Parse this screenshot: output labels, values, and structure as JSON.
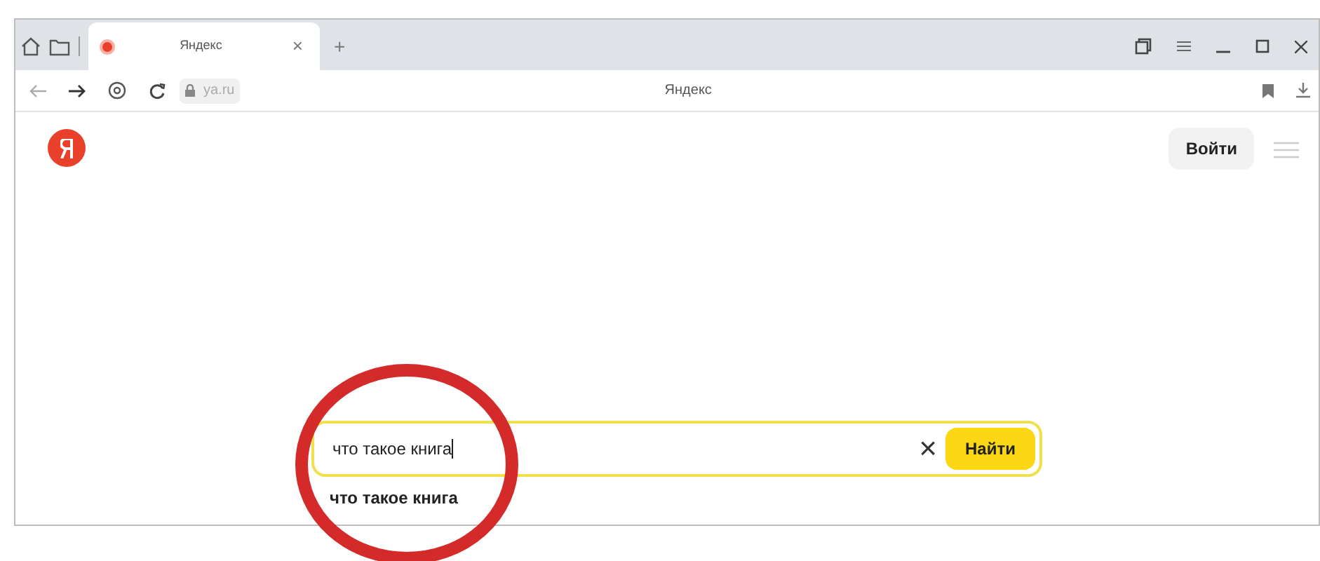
{
  "tabs": [
    {
      "title": "Яндекс",
      "close": "×",
      "selected": true
    }
  ],
  "new_tab": "+",
  "address_bar": {
    "url": "ya.ru",
    "page_title": "Яндекс"
  },
  "header": {
    "login_button": "Войти"
  },
  "search": {
    "value": "что такое книга",
    "clear": "×",
    "button": "Найти"
  },
  "suggestions": [
    "что такое книга"
  ],
  "annotation": {
    "kind": "circle",
    "color": "#d42a2a"
  }
}
